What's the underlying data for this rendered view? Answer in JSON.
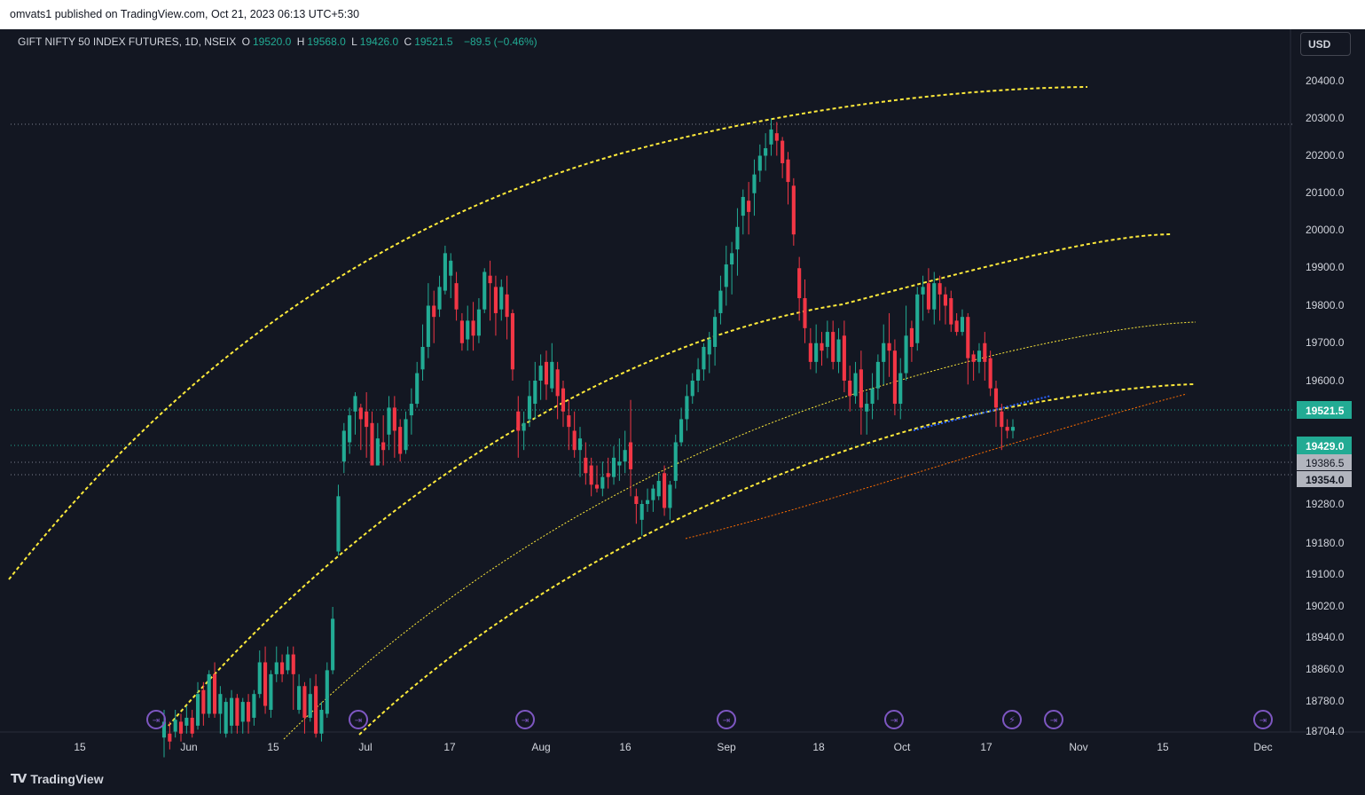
{
  "publisher": {
    "text": "omvats1 published on TradingView.com, Oct 21, 2023 06:13 UTC+5:30"
  },
  "legend": {
    "symbol": "GIFT NIFTY 50 INDEX FUTURES, 1D, NSEIX",
    "o_key": "O",
    "o_val": "19520.0",
    "h_key": "H",
    "h_val": "19568.0",
    "l_key": "L",
    "l_val": "19426.0",
    "c_key": "C",
    "c_val": "19521.5",
    "change": "−89.5 (−0.46%)"
  },
  "currency_button": "USD",
  "footer": {
    "logo_text": "TradingView",
    "logo_icon": "tradingview-logo-icon"
  },
  "colors": {
    "bg": "#131722",
    "up": "#22ab94",
    "down": "#f23645",
    "channel": "#ffeb3b",
    "support": "#ff6d00",
    "trend": "#2962ff",
    "axis_text": "#d1d4dc",
    "event": "#7e57c2"
  },
  "chart_data": {
    "type": "candlestick",
    "ylim": [
      18704,
      20480
    ],
    "y_ticks": [
      "20400.0",
      "20300.0",
      "20200.0",
      "20100.0",
      "20000.0",
      "19900.0",
      "19800.0",
      "19700.0",
      "19600.0",
      "19280.0",
      "19180.0",
      "19100.0",
      "19020.0",
      "18940.0",
      "18860.0",
      "18780.0",
      "18704.0"
    ],
    "x_labels": [
      "15",
      "Jun",
      "15",
      "Jul",
      "17",
      "Aug",
      "16",
      "Sep",
      "18",
      "Oct",
      "17",
      "Nov",
      "15",
      "Dec"
    ],
    "price_tags": [
      {
        "label": "19521.5",
        "bg": "#22ab94",
        "fg": "#ffffff"
      },
      {
        "label": "19429.0",
        "bg": "#22ab94",
        "fg": "#ffffff"
      },
      {
        "label": "19386.5",
        "bg": "#b2b5be",
        "fg": "#131722"
      },
      {
        "label": "19354.0",
        "bg": "#b2b5be",
        "fg": "#131722"
      }
    ],
    "candles": [
      [
        18690,
        18730,
        18640,
        18760
      ],
      [
        18700,
        18680,
        18660,
        18730
      ],
      [
        18705,
        18735,
        18690,
        18760
      ],
      [
        18730,
        18700,
        18680,
        18750
      ],
      [
        18720,
        18740,
        18700,
        18770
      ],
      [
        18740,
        18700,
        18690,
        18760
      ],
      [
        18720,
        18800,
        18710,
        18830
      ],
      [
        18810,
        18750,
        18720,
        18830
      ],
      [
        18750,
        18850,
        18740,
        18860
      ],
      [
        18850,
        18750,
        18740,
        18880
      ],
      [
        18750,
        18800,
        18700,
        18820
      ],
      [
        18700,
        18780,
        18690,
        18790
      ],
      [
        18720,
        18790,
        18700,
        18810
      ],
      [
        18790,
        18720,
        18700,
        18800
      ],
      [
        18730,
        18780,
        18700,
        18790
      ],
      [
        18780,
        18730,
        18700,
        18800
      ],
      [
        18740,
        18800,
        18720,
        18810
      ],
      [
        18800,
        18880,
        18790,
        18910
      ],
      [
        18880,
        18770,
        18750,
        18920
      ],
      [
        18760,
        18850,
        18740,
        18860
      ],
      [
        18850,
        18880,
        18830,
        18920
      ],
      [
        18880,
        18850,
        18830,
        18900
      ],
      [
        18860,
        18900,
        18850,
        18920
      ],
      [
        18900,
        18850,
        18760,
        18920
      ],
      [
        18760,
        18820,
        18750,
        18850
      ],
      [
        18820,
        18740,
        18700,
        18830
      ],
      [
        18740,
        18800,
        18730,
        18840
      ],
      [
        18820,
        18700,
        18690,
        18850
      ],
      [
        18700,
        18760,
        18680,
        18780
      ],
      [
        18750,
        18860,
        18740,
        18880
      ],
      [
        18860,
        18990,
        18850,
        19020
      ],
      [
        19160,
        19300,
        19150,
        19330
      ],
      [
        19390,
        19470,
        19360,
        19490
      ],
      [
        19440,
        19510,
        19410,
        19530
      ],
      [
        19520,
        19560,
        19460,
        19570
      ],
      [
        19530,
        19500,
        19420,
        19540
      ],
      [
        19520,
        19480,
        19400,
        19570
      ],
      [
        19490,
        19380,
        19380,
        19520
      ],
      [
        19380,
        19450,
        19380,
        19490
      ],
      [
        19440,
        19420,
        19380,
        19510
      ],
      [
        19460,
        19530,
        19420,
        19560
      ],
      [
        19530,
        19470,
        19400,
        19560
      ],
      [
        19480,
        19410,
        19390,
        19500
      ],
      [
        19420,
        19500,
        19410,
        19520
      ],
      [
        19510,
        19540,
        19460,
        19580
      ],
      [
        19540,
        19620,
        19530,
        19650
      ],
      [
        19630,
        19690,
        19600,
        19750
      ],
      [
        19690,
        19800,
        19660,
        19860
      ],
      [
        19800,
        19770,
        19700,
        19840
      ],
      [
        19790,
        19850,
        19770,
        19880
      ],
      [
        19840,
        19940,
        19830,
        19960
      ],
      [
        19880,
        19920,
        19820,
        19940
      ],
      [
        19860,
        19790,
        19760,
        19890
      ],
      [
        19760,
        19700,
        19680,
        19780
      ],
      [
        19710,
        19760,
        19680,
        19800
      ],
      [
        19760,
        19720,
        19680,
        19810
      ],
      [
        19720,
        19790,
        19700,
        19820
      ],
      [
        19790,
        19890,
        19780,
        19900
      ],
      [
        19880,
        19860,
        19760,
        19920
      ],
      [
        19850,
        19780,
        19720,
        19880
      ],
      [
        19790,
        19850,
        19760,
        19870
      ],
      [
        19830,
        19770,
        19710,
        19880
      ],
      [
        19780,
        19630,
        19600,
        19790
      ],
      [
        19520,
        19470,
        19400,
        19560
      ],
      [
        19470,
        19490,
        19420,
        19520
      ],
      [
        19500,
        19560,
        19480,
        19600
      ],
      [
        19540,
        19600,
        19500,
        19650
      ],
      [
        19600,
        19640,
        19550,
        19670
      ],
      [
        19650,
        19590,
        19550,
        19680
      ],
      [
        19580,
        19650,
        19570,
        19700
      ],
      [
        19630,
        19560,
        19500,
        19650
      ],
      [
        19580,
        19520,
        19480,
        19600
      ],
      [
        19510,
        19480,
        19420,
        19550
      ],
      [
        19470,
        19420,
        19400,
        19520
      ],
      [
        19420,
        19450,
        19350,
        19480
      ],
      [
        19400,
        19360,
        19330,
        19440
      ],
      [
        19380,
        19330,
        19300,
        19400
      ],
      [
        19330,
        19320,
        19310,
        19380
      ],
      [
        19320,
        19350,
        19300,
        19390
      ],
      [
        19360,
        19350,
        19320,
        19400
      ],
      [
        19350,
        19400,
        19330,
        19430
      ],
      [
        19380,
        19390,
        19340,
        19450
      ],
      [
        19390,
        19420,
        19360,
        19470
      ],
      [
        19440,
        19370,
        19300,
        19550
      ],
      [
        19300,
        19280,
        19230,
        19320
      ],
      [
        19240,
        19280,
        19200,
        19290
      ],
      [
        19280,
        19290,
        19260,
        19320
      ],
      [
        19290,
        19320,
        19260,
        19330
      ],
      [
        19300,
        19340,
        19290,
        19360
      ],
      [
        19360,
        19270,
        19250,
        19380
      ],
      [
        19270,
        19330,
        19240,
        19340
      ],
      [
        19340,
        19440,
        19320,
        19460
      ],
      [
        19440,
        19500,
        19430,
        19530
      ],
      [
        19500,
        19560,
        19470,
        19590
      ],
      [
        19560,
        19600,
        19540,
        19620
      ],
      [
        19600,
        19630,
        19570,
        19660
      ],
      [
        19630,
        19690,
        19600,
        19700
      ],
      [
        19670,
        19710,
        19620,
        19730
      ],
      [
        19690,
        19770,
        19640,
        19790
      ],
      [
        19780,
        19840,
        19750,
        19880
      ],
      [
        19850,
        19910,
        19800,
        19960
      ],
      [
        19910,
        19940,
        19830,
        19970
      ],
      [
        19950,
        20010,
        19880,
        20060
      ],
      [
        20040,
        20090,
        19990,
        20110
      ],
      [
        20080,
        20050,
        19990,
        20130
      ],
      [
        20100,
        20150,
        20040,
        20190
      ],
      [
        20160,
        20200,
        20130,
        20230
      ],
      [
        20200,
        20220,
        20160,
        20260
      ],
      [
        20230,
        20270,
        20200,
        20300
      ],
      [
        20260,
        20240,
        20200,
        20290
      ],
      [
        20240,
        20180,
        20140,
        20250
      ],
      [
        20190,
        20130,
        20070,
        20210
      ],
      [
        20120,
        19990,
        19960,
        20140
      ],
      [
        19900,
        19820,
        19760,
        19930
      ],
      [
        19820,
        19740,
        19700,
        19870
      ],
      [
        19700,
        19650,
        19630,
        19740
      ],
      [
        19650,
        19700,
        19620,
        19750
      ],
      [
        19700,
        19680,
        19640,
        19730
      ],
      [
        19690,
        19730,
        19660,
        19760
      ],
      [
        19730,
        19650,
        19630,
        19760
      ],
      [
        19650,
        19710,
        19620,
        19740
      ],
      [
        19720,
        19600,
        19570,
        19760
      ],
      [
        19600,
        19560,
        19520,
        19640
      ],
      [
        19560,
        19620,
        19540,
        19650
      ],
      [
        19630,
        19530,
        19460,
        19680
      ],
      [
        19520,
        19540,
        19460,
        19570
      ],
      [
        19540,
        19580,
        19500,
        19620
      ],
      [
        19580,
        19650,
        19550,
        19670
      ],
      [
        19650,
        19700,
        19590,
        19750
      ],
      [
        19700,
        19680,
        19610,
        19780
      ],
      [
        19680,
        19540,
        19510,
        19710
      ],
      [
        19540,
        19620,
        19500,
        19660
      ],
      [
        19620,
        19720,
        19600,
        19800
      ],
      [
        19740,
        19690,
        19650,
        19760
      ],
      [
        19700,
        19830,
        19680,
        19850
      ],
      [
        19830,
        19850,
        19760,
        19880
      ],
      [
        19860,
        19790,
        19780,
        19900
      ],
      [
        19790,
        19860,
        19750,
        19890
      ],
      [
        19860,
        19830,
        19760,
        19880
      ],
      [
        19830,
        19800,
        19750,
        19850
      ],
      [
        19820,
        19750,
        19730,
        19840
      ],
      [
        19760,
        19730,
        19720,
        19780
      ],
      [
        19730,
        19770,
        19720,
        19790
      ],
      [
        19770,
        19660,
        19590,
        19780
      ],
      [
        19670,
        19650,
        19600,
        19680
      ],
      [
        19650,
        19680,
        19620,
        19700
      ],
      [
        19700,
        19650,
        19600,
        19730
      ],
      [
        19660,
        19580,
        19560,
        19680
      ],
      [
        19580,
        19530,
        19480,
        19600
      ],
      [
        19520,
        19480,
        19420,
        19540
      ],
      [
        19480,
        19470,
        19450,
        19500
      ],
      [
        19470,
        19480,
        19450,
        19500
      ]
    ]
  }
}
